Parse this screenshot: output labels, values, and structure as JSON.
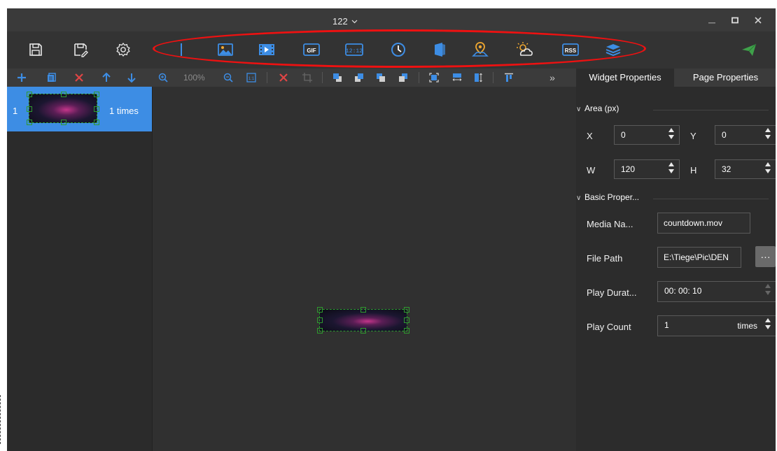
{
  "window": {
    "title": "122"
  },
  "toolbar": {
    "icons": [
      "save-icon",
      "save-as-icon",
      "settings-icon",
      "image-icon",
      "video-icon",
      "gif-icon",
      "digital-clock-icon",
      "analog-clock-icon",
      "office-icon",
      "location-icon",
      "weather-icon",
      "rss-icon",
      "layers-icon",
      "send-icon"
    ],
    "gif_label": "GIF",
    "clock_label": "12:12",
    "rss_label": "RSS",
    "accent": "#3d8de4"
  },
  "subbar": {
    "zoom": "100%",
    "zoom_reset_label": "1:1",
    "more_label": "»"
  },
  "tabs": {
    "widget": "Widget Properties",
    "page": "Page Properties"
  },
  "pages": [
    {
      "number": "1",
      "times": "1 times"
    }
  ],
  "props": {
    "area_title": "Area (px)",
    "x_label": "X",
    "x_value": "0",
    "y_label": "Y",
    "y_value": "0",
    "w_label": "W",
    "w_value": "120",
    "h_label": "H",
    "h_value": "32",
    "basic_title": "Basic Proper...",
    "media_name_label": "Media Na...",
    "media_name_value": "countdown.mov",
    "file_path_label": "File Path",
    "file_path_value": "E:\\Tiege\\Pic\\DEN",
    "more_button": "···",
    "play_duration_label": "Play Durat...",
    "play_duration_value": "00: 00: 10",
    "play_count_label": "Play Count",
    "play_count_value": "1",
    "play_count_unit": "times"
  },
  "colors": {
    "highlight": "#ee1111",
    "send": "#3fa14a",
    "selection": "#2f9a2f"
  }
}
